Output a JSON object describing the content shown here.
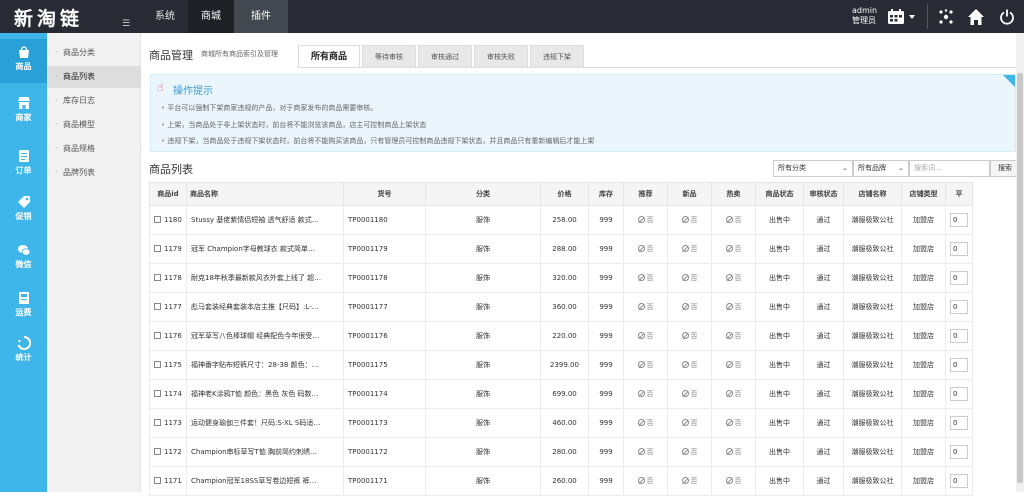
{
  "app": {
    "logo": "新淘链",
    "menu_toggle": "☰"
  },
  "topnav": [
    {
      "label": "系统"
    },
    {
      "label": "商城"
    },
    {
      "label": "插件"
    }
  ],
  "user": {
    "name": "admin",
    "role": "管理员"
  },
  "modules": [
    {
      "label": "商品",
      "icon": "bag-icon"
    },
    {
      "label": "商家",
      "icon": "store-icon"
    },
    {
      "label": "订单",
      "icon": "order-icon"
    },
    {
      "label": "促销",
      "icon": "promo-icon"
    },
    {
      "label": "微信",
      "icon": "wechat-icon"
    },
    {
      "label": "运费",
      "icon": "freight-icon"
    },
    {
      "label": "统计",
      "icon": "stats-icon"
    }
  ],
  "subnav": [
    {
      "label": "商品分类"
    },
    {
      "label": "商品列表"
    },
    {
      "label": "库存日志"
    },
    {
      "label": "商品模型"
    },
    {
      "label": "商品规格"
    },
    {
      "label": "品牌列表"
    }
  ],
  "page": {
    "title": "商品管理",
    "subtitle": "商城所有商品索引及管理",
    "tabs": [
      {
        "label": "所有商品"
      },
      {
        "label": "等待审核"
      },
      {
        "label": "审核通过"
      },
      {
        "label": "审核失败"
      },
      {
        "label": "违规下架"
      }
    ]
  },
  "tips": {
    "title": "操作提示",
    "lines": [
      "平台可以强制下架商家违规的产品，对于商家发布的商品需要审核。",
      "上架，当商品处于非上架状态时，前台将不能浏览该商品，店主可控制商品上架状态",
      "违规下架，当商品处于违规下架状态时，前台将不能购买该商品，只有管理员可控制商品违规下架状态，并且商品只有重新编辑后才能上架"
    ]
  },
  "list": {
    "title": "商品列表",
    "filter_category": "所有分类",
    "filter_brand": "所有品牌",
    "search_placeholder": "搜索词...",
    "search_button": "搜索",
    "columns": [
      "商品id",
      "商品名称",
      "货号",
      "分类",
      "价格",
      "库存",
      "推荐",
      "新品",
      "热卖",
      "商品状态",
      "审核状态",
      "店铺名称",
      "店铺类型",
      "平"
    ],
    "no_label": "否",
    "rows": [
      {
        "id": "1180",
        "name": "Stussy 基佬紫情侣短袖 透气舒适 款式…",
        "sku": "TP0001180",
        "cat": "服饰",
        "price": "258.00",
        "stock": "999",
        "status": "出售中",
        "audit": "通过",
        "shop": "潮服极致公社",
        "shop_type": "加盟店",
        "sort": "0"
      },
      {
        "id": "1179",
        "name": "冠军 Champion字母教球衣 款式简单…",
        "sku": "TP0001179",
        "cat": "服饰",
        "price": "288.00",
        "stock": "999",
        "status": "出售中",
        "audit": "通过",
        "shop": "潮服极致公社",
        "shop_type": "加盟店",
        "sort": "0"
      },
      {
        "id": "1178",
        "name": "耐克18年秋季最新款风衣外套上线了 超…",
        "sku": "TP0001178",
        "cat": "服饰",
        "price": "320.00",
        "stock": "999",
        "status": "出售中",
        "audit": "通过",
        "shop": "潮服极致公社",
        "shop_type": "加盟店",
        "sort": "0"
      },
      {
        "id": "1177",
        "name": "彪马套装经典套装本店主推【尺码】:L-…",
        "sku": "TP0001177",
        "cat": "服饰",
        "price": "360.00",
        "stock": "999",
        "status": "出售中",
        "audit": "通过",
        "shop": "潮服极致公社",
        "shop_type": "加盟店",
        "sort": "0"
      },
      {
        "id": "1176",
        "name": "冠军草写八色棒球帽 经典配色今年很受…",
        "sku": "TP0001176",
        "cat": "服饰",
        "price": "220.00",
        "stock": "999",
        "status": "出售中",
        "audit": "通过",
        "shop": "潮服极致公社",
        "shop_type": "加盟店",
        "sort": "0"
      },
      {
        "id": "1175",
        "name": "福神番字贴布短裤尺寸：28-38 颜色：…",
        "sku": "TP0001175",
        "cat": "服饰",
        "price": "2399.00",
        "stock": "999",
        "status": "出售中",
        "audit": "通过",
        "shop": "潮服极致公社",
        "shop_type": "加盟店",
        "sort": "0"
      },
      {
        "id": "1174",
        "name": "福神老K涂鸦T恤 颜色：黑色 灰色 码数…",
        "sku": "TP0001174",
        "cat": "服饰",
        "price": "699.00",
        "stock": "999",
        "status": "出售中",
        "audit": "通过",
        "shop": "潮服极致公社",
        "shop_type": "加盟店",
        "sort": "0"
      },
      {
        "id": "1173",
        "name": "运动健身瑜伽三件套！尺码:S-XL S码适…",
        "sku": "TP0001173",
        "cat": "服饰",
        "price": "460.00",
        "stock": "999",
        "status": "出售中",
        "audit": "通过",
        "shop": "潮服极致公社",
        "shop_type": "加盟店",
        "sort": "0"
      },
      {
        "id": "1172",
        "name": "Champion串标草写T恤 胸前简约刺绣…",
        "sku": "TP0001172",
        "cat": "服饰",
        "price": "280.00",
        "stock": "999",
        "status": "出售中",
        "audit": "通过",
        "shop": "潮服极致公社",
        "shop_type": "加盟店",
        "sort": "0"
      },
      {
        "id": "1171",
        "name": "Champion冠军18SS草写卷边短裤 裤…",
        "sku": "TP0001171",
        "cat": "服饰",
        "price": "260.00",
        "stock": "999",
        "status": "出售中",
        "audit": "通过",
        "shop": "潮服极致公社",
        "shop_type": "加盟店",
        "sort": "0"
      }
    ]
  },
  "colors": {
    "topbar": "#282b33",
    "module_bar": "#3fb6ea",
    "tips_bg": "#eaf6fc",
    "tips_title": "#3a9bd5"
  }
}
